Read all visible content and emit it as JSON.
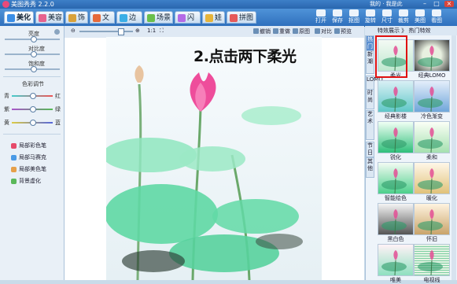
{
  "window": {
    "title": "美图秀秀 2.2.0",
    "user_links": "我的 · 我是此"
  },
  "tabs": [
    {
      "label": "美化",
      "active": true,
      "icon": "beautify-icon"
    },
    {
      "label": "美容",
      "icon": "makeup-icon"
    },
    {
      "label": "饰品",
      "icon": "accessory-icon"
    },
    {
      "label": "文字",
      "icon": "text-icon"
    },
    {
      "label": "边框",
      "icon": "frame-icon"
    },
    {
      "label": "场景",
      "icon": "scene-icon"
    },
    {
      "label": "闪图",
      "icon": "flash-icon"
    },
    {
      "label": "娃娃",
      "icon": "doll-icon"
    },
    {
      "label": "拼图",
      "icon": "puzzle-icon"
    }
  ],
  "right_tools": [
    "打开",
    "保存",
    "抠图",
    "旋转",
    "尺寸",
    "裁剪",
    "美图",
    "看图"
  ],
  "left_panel": {
    "sliders": [
      "亮度",
      "对比度",
      "饱和度"
    ],
    "color_section": "色彩调节",
    "color_rows": [
      {
        "left": "青",
        "right": "红"
      },
      {
        "left": "紫",
        "right": "绿"
      },
      {
        "left": "黄",
        "right": "蓝"
      }
    ],
    "tools": [
      "局部彩色笔",
      "局部马赛克",
      "局部美色笔",
      "背景虚化"
    ]
  },
  "canvas_toolbar": {
    "zoom_ratio": "1:1",
    "actions": [
      "撤销",
      "重做",
      "原图",
      "对比",
      "预览"
    ]
  },
  "overlay_text": "2.点击两下柔光",
  "right_panel": {
    "header": "特效展示 》 热门特效",
    "vtabs": [
      "热门",
      "新潮",
      "LOMO",
      "时尚",
      "艺术",
      "节日",
      "其他"
    ],
    "effects": [
      "柔光",
      "经典LOMO",
      "经典影楼",
      "冷色渐变",
      "锐化",
      "柔和",
      "智能绘色",
      "暖化",
      "黑白色",
      "怀旧",
      "唯美",
      "电视线"
    ],
    "selected_effect": "柔光"
  },
  "colors": {
    "accent": "#2f70bd",
    "highlight": "#e01010",
    "lotus": "#ee4d9b",
    "leaf": "#5dd6a0"
  }
}
